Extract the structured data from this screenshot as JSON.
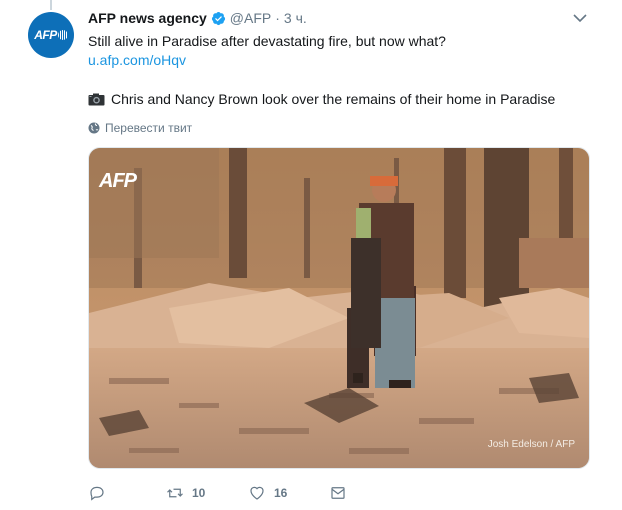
{
  "tweet": {
    "author_name": "AFP news agency",
    "handle": "@AFP",
    "separator": "·",
    "time": "3 ч.",
    "text_line1": "Still alive in Paradise after devastating fire, but now what?",
    "link": "u.afp.com/oHqv",
    "caption": "Chris and Nancy Brown look over the remains of their home in Paradise",
    "translate_label": "Перевести твит"
  },
  "avatar": {
    "logo_text": "AFP"
  },
  "media": {
    "watermark": "AFP",
    "credit": "Josh Edelson / AFP"
  },
  "actions": {
    "reply_count": "",
    "retweet_count": "10",
    "like_count": "16"
  },
  "icons": {
    "verified": "verified-badge-icon",
    "caret": "chevron-down-icon",
    "camera": "camera-icon",
    "globe": "globe-icon",
    "reply": "reply-icon",
    "retweet": "retweet-icon",
    "like": "heart-icon",
    "message": "envelope-icon"
  },
  "colors": {
    "link": "#1b95e0",
    "muted": "#657786",
    "verified": "#1da1f2",
    "avatar_bg": "#0d6fb8"
  }
}
